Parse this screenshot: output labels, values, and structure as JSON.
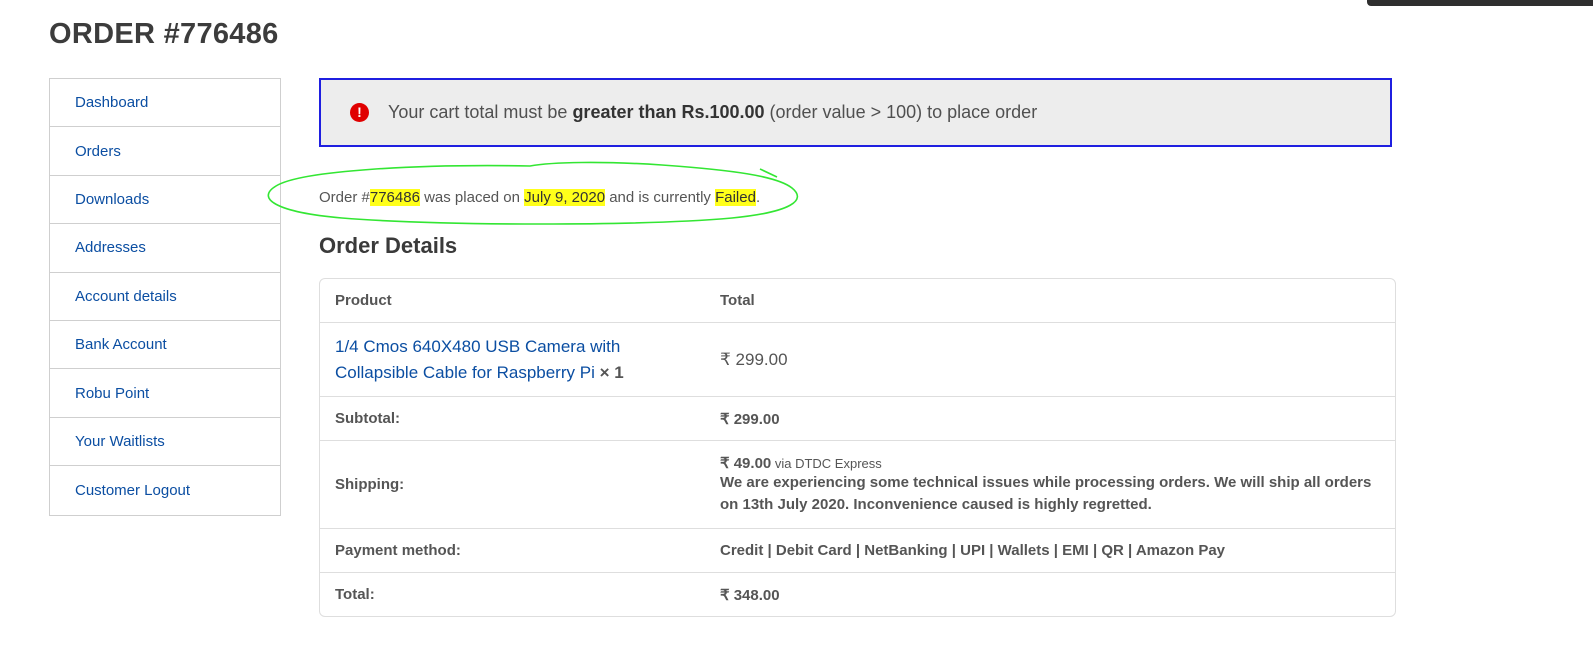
{
  "page": {
    "title": "ORDER #776486"
  },
  "sidebar": {
    "items": [
      {
        "label": "Dashboard"
      },
      {
        "label": "Orders"
      },
      {
        "label": "Downloads"
      },
      {
        "label": "Addresses"
      },
      {
        "label": "Account details"
      },
      {
        "label": "Bank Account"
      },
      {
        "label": "Robu Point"
      },
      {
        "label": "Your Waitlists"
      },
      {
        "label": "Customer Logout"
      }
    ]
  },
  "notice": {
    "icon": "exclamation-icon",
    "prefix": "Your cart total must be ",
    "bold": "greater than Rs.100.00",
    "suffix": " (order value > 100) to place order",
    "border_color": "#1f1fe0",
    "icon_color": "#e00000"
  },
  "status": {
    "part1": "Order #",
    "order_number": "776486",
    "part2": " was placed on ",
    "date": "July 9, 2020",
    "part3": " and is currently ",
    "state": "Failed",
    "part4": ".",
    "highlight_color": "#ffff1a",
    "annotation_color": "#33e633"
  },
  "details": {
    "heading": "Order Details",
    "columns": {
      "product": "Product",
      "total": "Total"
    },
    "product": {
      "name_line1": "1/4 Cmos 640X480 USB Camera with",
      "name_line2": "Collapsible Cable for Raspberry Pi",
      "qty": " × 1",
      "price": "₹ 299.00"
    },
    "subtotal": {
      "label": "Subtotal:",
      "value": "₹ 299.00"
    },
    "shipping": {
      "label": "Shipping:",
      "value": "₹ 49.00",
      "via": " via DTDC Express",
      "note_line1": "We are experiencing some technical issues while processing orders. We will ship all orders",
      "note_line2": "on 13th July 2020. Inconvenience caused is highly regretted."
    },
    "payment": {
      "label": "Payment method:",
      "value": "Credit | Debit Card | NetBanking | UPI | Wallets | EMI | QR | Amazon Pay"
    },
    "total": {
      "label": "Total:",
      "value": "₹ 348.00"
    }
  }
}
